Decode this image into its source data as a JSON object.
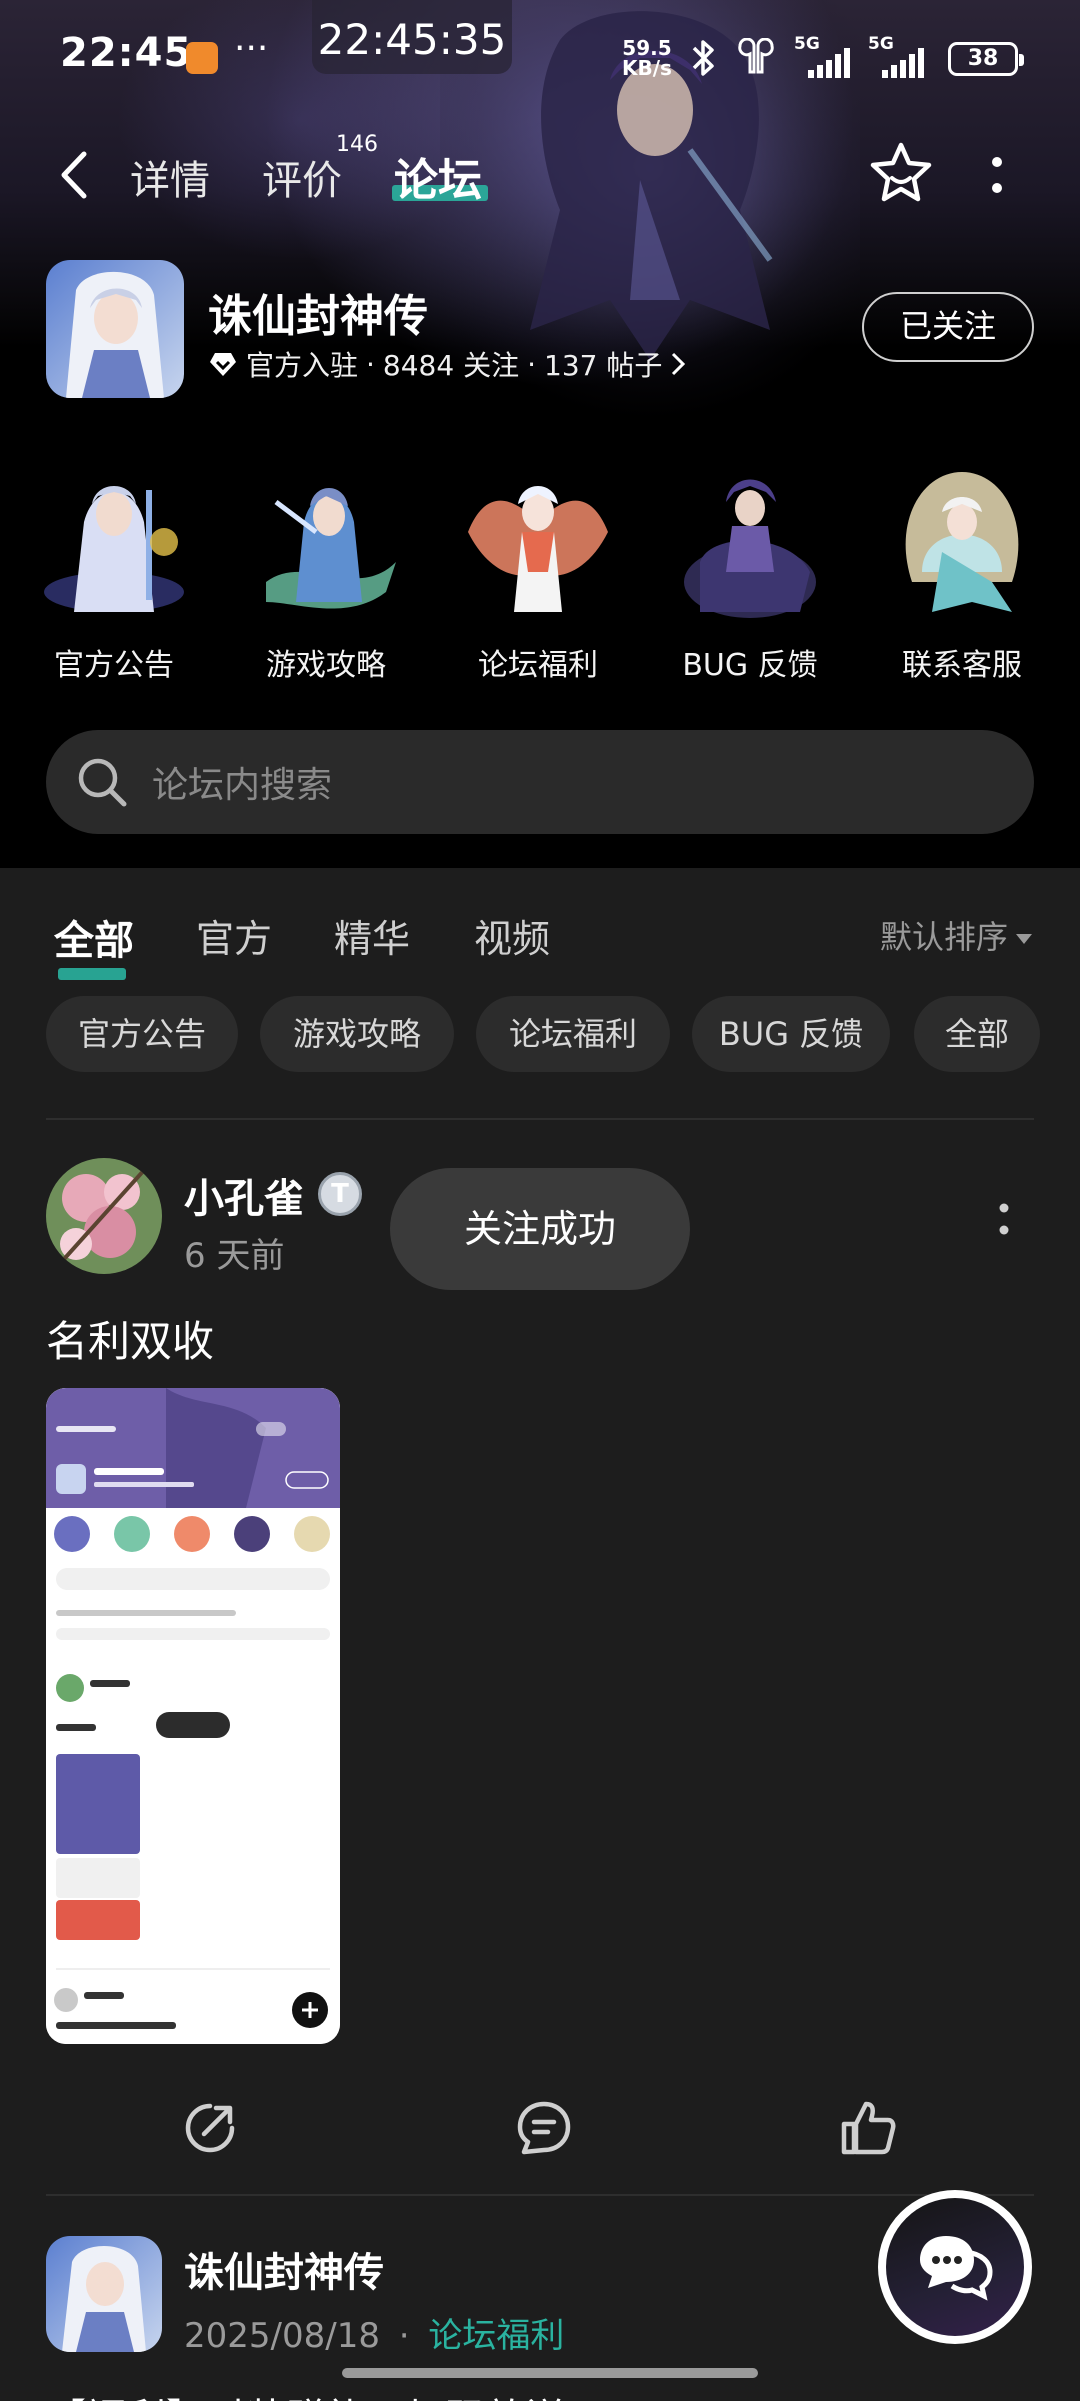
{
  "status_bar": {
    "time": "22:45",
    "dots": "···",
    "clock_overlay": "22:45:35",
    "net_speed_value": "59.5",
    "net_speed_unit": "KB/s",
    "signal1": "5G",
    "signal2": "5G",
    "battery": "38"
  },
  "nav": {
    "tabs": [
      {
        "label": "详情"
      },
      {
        "label": "评价",
        "badge": "146"
      },
      {
        "label": "论坛"
      }
    ],
    "active_tab": "论坛"
  },
  "game": {
    "name": "诛仙封神传",
    "official_label": "官方入驻",
    "followers": "8484 关注",
    "posts": "137 帖子",
    "sep": "·",
    "follow_button": "已关注"
  },
  "categories": [
    {
      "label": "官方公告"
    },
    {
      "label": "游戏攻略"
    },
    {
      "label": "论坛福利"
    },
    {
      "label": "BUG 反馈"
    },
    {
      "label": "联系客服"
    }
  ],
  "search": {
    "placeholder": "论坛内搜索"
  },
  "feed_tabs": [
    {
      "label": "全部"
    },
    {
      "label": "官方"
    },
    {
      "label": "精华"
    },
    {
      "label": "视频"
    }
  ],
  "sort_label": "默认排序",
  "chips": [
    {
      "label": "官方公告"
    },
    {
      "label": "游戏攻略"
    },
    {
      "label": "论坛福利"
    },
    {
      "label": "BUG 反馈"
    },
    {
      "label": "全部"
    }
  ],
  "post1": {
    "author": "小孔雀",
    "badge": "T",
    "time": "6 天前",
    "toast": "关注成功",
    "title": "名利双收"
  },
  "post2": {
    "author": "诛仙封神传",
    "date": "2025/08/18",
    "sep": "·",
    "category": "论坛福利",
    "title": "【福利】时装赠礼，加码放送！"
  },
  "colors": {
    "accent": "#2ab3a0",
    "background": "#1d1d1d",
    "chip_bg": "#2c2c2c"
  }
}
